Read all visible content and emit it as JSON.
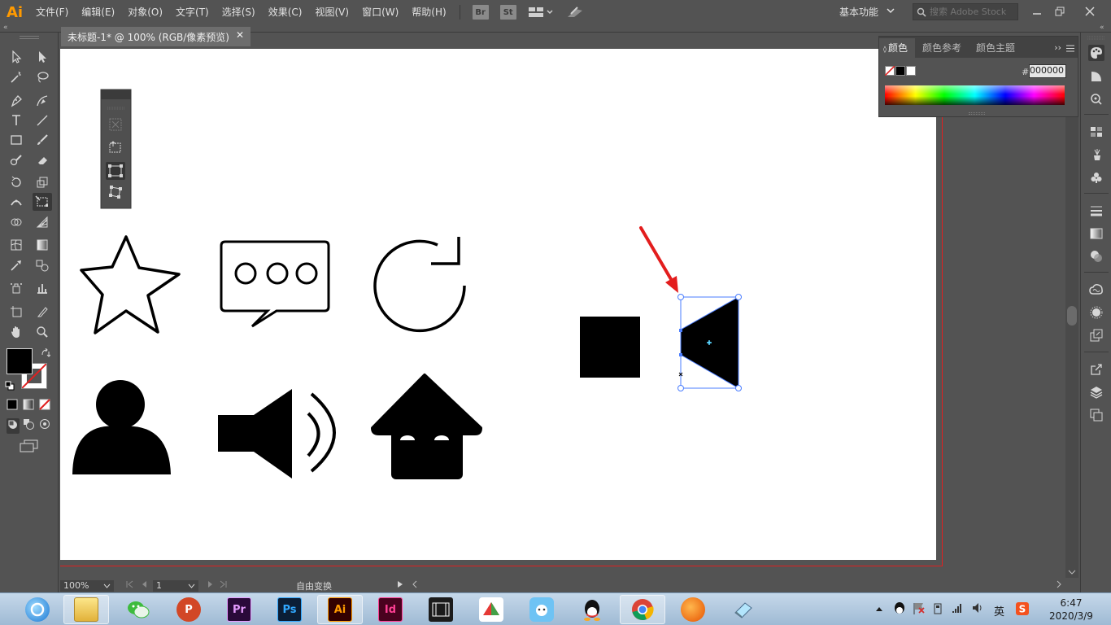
{
  "app": {
    "logo": "Ai",
    "menu": [
      "文件(F)",
      "编辑(E)",
      "对象(O)",
      "文字(T)",
      "选择(S)",
      "效果(C)",
      "视图(V)",
      "窗口(W)",
      "帮助(H)"
    ],
    "bridge_label": "Br",
    "stock_label": "St",
    "workspace": "基本功能",
    "search_placeholder": "搜索 Adobe Stock"
  },
  "document": {
    "tab_title": "未标题-1* @ 100% (RGB/像素预览)"
  },
  "status": {
    "zoom": "100%",
    "artboard_number": "1",
    "tool_name": "自由变换"
  },
  "color_panel": {
    "tabs": [
      "颜色",
      "颜色参考",
      "颜色主题"
    ],
    "hex_label": "#",
    "hex_value": "000000"
  },
  "colors": {
    "ui_bg": "#535353",
    "artboard": "#ffffff",
    "selection": "#4a7dff",
    "annotation_arrow": "#e31d1d",
    "fill": "#000000"
  },
  "taskbar": {
    "apps": [
      {
        "icon": "360-browser-icon"
      },
      {
        "icon": "file-explorer-icon"
      },
      {
        "icon": "wechat-icon"
      },
      {
        "icon": "powerpoint-icon",
        "label": "P"
      },
      {
        "icon": "premiere-icon",
        "label": "Pr"
      },
      {
        "icon": "photoshop-icon",
        "label": "Ps"
      },
      {
        "icon": "illustrator-icon",
        "label": "Ai"
      },
      {
        "icon": "indesign-icon",
        "label": "Id"
      },
      {
        "icon": "video-editor-icon"
      },
      {
        "icon": "umbrella-app-icon"
      },
      {
        "icon": "cartoon-app-icon"
      },
      {
        "icon": "qq-icon"
      },
      {
        "icon": "chrome-icon"
      },
      {
        "icon": "fox-app-icon"
      },
      {
        "icon": "eraser-app-icon"
      }
    ],
    "ime": "英",
    "time": "6:47",
    "date": "2020/3/9"
  }
}
